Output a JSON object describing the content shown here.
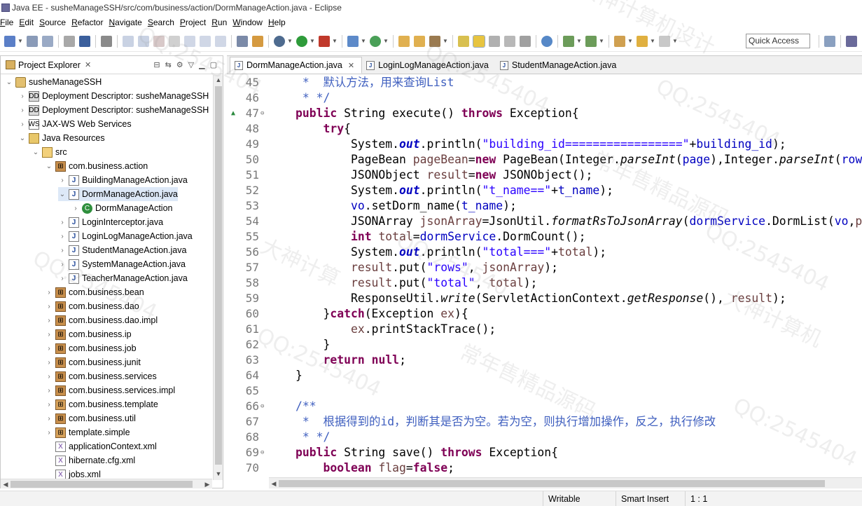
{
  "window": {
    "title": "Java EE - susheManageSSH/src/com/business/action/DormManageAction.java - Eclipse"
  },
  "menu": [
    "File",
    "Edit",
    "Source",
    "Refactor",
    "Navigate",
    "Search",
    "Project",
    "Run",
    "Window",
    "Help"
  ],
  "toolbar": {
    "quick_access": "Quick Access"
  },
  "explorer": {
    "tab_label": "Project Explorer",
    "tree": [
      {
        "label": "susheManageSSH",
        "icon": "project-icon",
        "expanded": true
      },
      {
        "label": "Deployment Descriptor: susheManageSSH",
        "icon": "deployment-descriptor-icon",
        "expanded": false
      },
      {
        "label": "Deployment Descriptor: susheManageSSH",
        "icon": "deployment-descriptor-icon",
        "expanded": false
      },
      {
        "label": "JAX-WS Web Services",
        "icon": "web-services-icon",
        "expanded": false
      },
      {
        "label": "Java Resources",
        "icon": "java-resources-icon",
        "expanded": true
      },
      {
        "label": "src",
        "icon": "source-folder-icon",
        "expanded": true
      },
      {
        "label": "com.business.action",
        "icon": "package-icon",
        "expanded": true
      },
      {
        "label": "BuildingManageAction.java",
        "icon": "java-file-icon",
        "expanded": false
      },
      {
        "label": "DormManageAction.java",
        "icon": "java-file-icon",
        "expanded": true,
        "selected": true
      },
      {
        "label": "DormManageAction",
        "icon": "class-icon",
        "expanded": false
      },
      {
        "label": "LoginInterceptor.java",
        "icon": "java-file-icon",
        "expanded": false
      },
      {
        "label": "LoginLogManageAction.java",
        "icon": "java-file-icon",
        "expanded": false
      },
      {
        "label": "StudentManageAction.java",
        "icon": "java-file-icon",
        "expanded": false
      },
      {
        "label": "SystemManageAction.java",
        "icon": "java-file-icon",
        "expanded": false
      },
      {
        "label": "TeacherManageAction.java",
        "icon": "java-file-icon",
        "expanded": false
      },
      {
        "label": "com.business.bean",
        "icon": "package-icon",
        "expanded": false
      },
      {
        "label": "com.business.dao",
        "icon": "package-icon",
        "expanded": false
      },
      {
        "label": "com.business.dao.impl",
        "icon": "package-icon",
        "expanded": false
      },
      {
        "label": "com.business.ip",
        "icon": "package-icon",
        "expanded": false
      },
      {
        "label": "com.business.job",
        "icon": "package-icon",
        "expanded": false
      },
      {
        "label": "com.business.junit",
        "icon": "package-icon",
        "expanded": false
      },
      {
        "label": "com.business.services",
        "icon": "package-icon",
        "expanded": false
      },
      {
        "label": "com.business.services.impl",
        "icon": "package-icon",
        "expanded": false
      },
      {
        "label": "com.business.template",
        "icon": "template-package-icon",
        "expanded": false
      },
      {
        "label": "com.business.util",
        "icon": "package-icon",
        "expanded": false
      },
      {
        "label": "template.simple",
        "icon": "template-package-icon",
        "expanded": false
      },
      {
        "label": "applicationContext.xml",
        "icon": "xml-file-icon",
        "expanded": false
      },
      {
        "label": "hibernate.cfg.xml",
        "icon": "xml-file-icon",
        "expanded": false
      },
      {
        "label": "jobs.xml",
        "icon": "xml-file-icon",
        "expanded": false
      }
    ]
  },
  "editor": {
    "tabs": [
      {
        "label": "DormManageAction.java",
        "active": true,
        "closable": true
      },
      {
        "label": "LoginLogManageAction.java",
        "active": false,
        "closable": false
      },
      {
        "label": "StudentManageAction.java",
        "active": false,
        "closable": false
      }
    ],
    "lines": [
      {
        "n": "45",
        "mark": "",
        "fold": "",
        "code": "<span class=\"cmt\"> *  默认方法，用来查询List</span>"
      },
      {
        "n": "46",
        "mark": "",
        "fold": "",
        "code": "<span class=\"cmt\"> * */</span>"
      },
      {
        "n": "47",
        "mark": "▲",
        "fold": "⊖",
        "code": "<span class=\"kw\">public</span> String execute() <span class=\"kw\">throws</span> Exception{"
      },
      {
        "n": "48",
        "mark": "",
        "fold": "",
        "code": "    <span class=\"kw\">try</span>{"
      },
      {
        "n": "49",
        "mark": "",
        "fold": "",
        "code": "        System.<span class=\"sf\">out</span>.println(<span class=\"str\">\"building_id=================\"</span>+<span class=\"fld\">building_id</span>);"
      },
      {
        "n": "50",
        "mark": "",
        "fold": "",
        "code": "        PageBean <span class=\"var\">pageBean</span>=<span class=\"kw\">new</span> PageBean(Integer.<span class=\"it\">parseInt</span>(<span class=\"fld\">page</span>),Integer.<span class=\"it\">parseInt</span>(<span class=\"fld\">rows</span>));"
      },
      {
        "n": "51",
        "mark": "",
        "fold": "",
        "code": "        JSONObject <span class=\"var\">result</span>=<span class=\"kw\">new</span> JSONObject();"
      },
      {
        "n": "52",
        "mark": "",
        "fold": "",
        "code": "        System.<span class=\"sf\">out</span>.println(<span class=\"str\">\"t_name==\"</span>+<span class=\"fld\">t_name</span>);"
      },
      {
        "n": "53",
        "mark": "",
        "fold": "",
        "code": "        <span class=\"fld\">vo</span>.setDorm_name(<span class=\"fld\">t_name</span>);"
      },
      {
        "n": "54",
        "mark": "",
        "fold": "",
        "code": "        JSONArray <span class=\"var\">jsonArray</span>=JsonUtil.<span class=\"it\">formatRsToJsonArray</span>(<span class=\"fld\">dormService</span>.DormList(<span class=\"fld\">vo</span>,<span class=\"var\">pageBean</span>));"
      },
      {
        "n": "55",
        "mark": "",
        "fold": "",
        "code": "        <span class=\"kw\">int</span> <span class=\"var\">total</span>=<span class=\"fld\">dormService</span>.DormCount();"
      },
      {
        "n": "56",
        "mark": "",
        "fold": "",
        "code": "        System.<span class=\"sf\">out</span>.println(<span class=\"str\">\"total===\"</span>+<span class=\"var\">total</span>);"
      },
      {
        "n": "57",
        "mark": "",
        "fold": "",
        "code": "        <span class=\"var\">result</span>.put(<span class=\"str\">\"rows\"</span>, <span class=\"var\">jsonArray</span>);"
      },
      {
        "n": "58",
        "mark": "",
        "fold": "",
        "code": "        <span class=\"var\">result</span>.put(<span class=\"str\">\"total\"</span>, <span class=\"var\">total</span>);"
      },
      {
        "n": "59",
        "mark": "",
        "fold": "",
        "code": "        ResponseUtil.<span class=\"it\">write</span>(ServletActionContext.<span class=\"it\">getResponse</span>(), <span class=\"var\">result</span>);"
      },
      {
        "n": "60",
        "mark": "",
        "fold": "",
        "code": "    }<span class=\"kw\">catch</span>(Exception <span class=\"var\">ex</span>){"
      },
      {
        "n": "61",
        "mark": "",
        "fold": "",
        "code": "        <span class=\"var\">ex</span>.printStackTrace();"
      },
      {
        "n": "62",
        "mark": "",
        "fold": "",
        "code": "    }"
      },
      {
        "n": "63",
        "mark": "",
        "fold": "",
        "code": "    <span class=\"kw\">return</span> <span class=\"kw\">null</span>;"
      },
      {
        "n": "64",
        "mark": "",
        "fold": "",
        "code": "}"
      },
      {
        "n": "65",
        "mark": "",
        "fold": "",
        "code": ""
      },
      {
        "n": "66",
        "mark": "",
        "fold": "⊖",
        "code": "<span class=\"cmt\">/**</span>"
      },
      {
        "n": "67",
        "mark": "",
        "fold": "",
        "code": "<span class=\"cmt\"> *  根据得到的id，判断其是否为空。若为空，则执行增加操作，反之，执行修改</span>"
      },
      {
        "n": "68",
        "mark": "",
        "fold": "",
        "code": "<span class=\"cmt\"> * */</span>"
      },
      {
        "n": "69",
        "mark": "",
        "fold": "⊖",
        "code": "<span class=\"kw\">public</span> String save() <span class=\"kw\">throws</span> Exception{"
      },
      {
        "n": "70",
        "mark": "",
        "fold": "",
        "code": "    <span class=\"kw\">boolean</span> <span class=\"var\">flag</span>=<span class=\"kw\">false</span>;"
      }
    ]
  },
  "status": {
    "writable": "Writable",
    "insert_mode": "Smart Insert",
    "position": "1 : 1"
  },
  "watermarks": [
    "QQ:2545404",
    "QQ:2545404",
    "大神计算机设计",
    "QQ:2545404",
    "常年售精品源码",
    "QQ:2545404",
    "大神计算",
    "QQ:254540",
    "QQ:2545404",
    "常年售精品源码",
    "QQ:2545404",
    "大神计算机",
    "QQ:2545404"
  ]
}
